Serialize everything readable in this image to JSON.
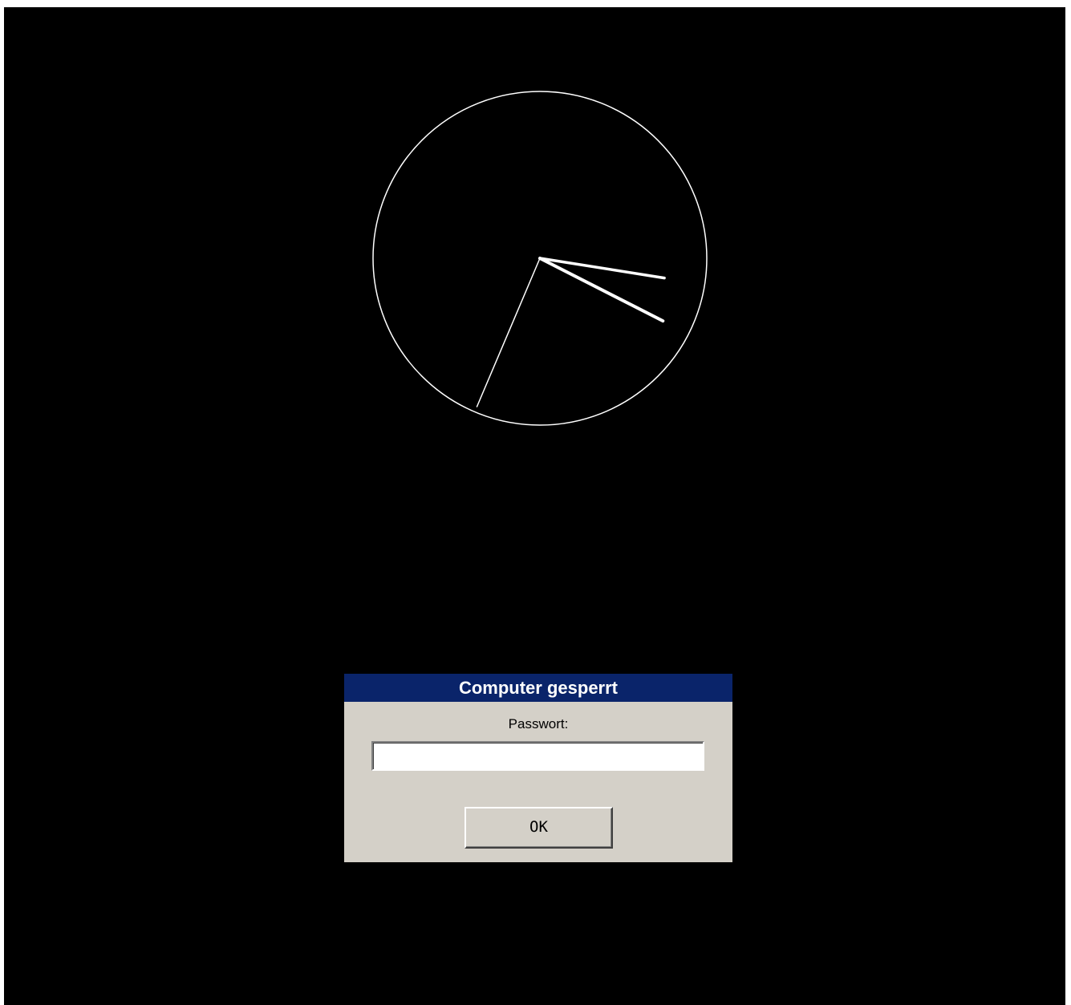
{
  "lock_dialog": {
    "title": "Computer gesperrt",
    "password_label": "Passwort:",
    "password_value": "",
    "ok_label": "OK"
  },
  "clock": {
    "icon": "analog-clock-icon",
    "hour_hand_angle_deg": 117,
    "minute_hand_angle_deg": 99,
    "second_hand_angle_deg": 203,
    "stroke_color": "#ffffff"
  },
  "colors": {
    "background": "#000000",
    "titlebar": "#0a246a",
    "dialog_face": "#d4d0c8"
  }
}
